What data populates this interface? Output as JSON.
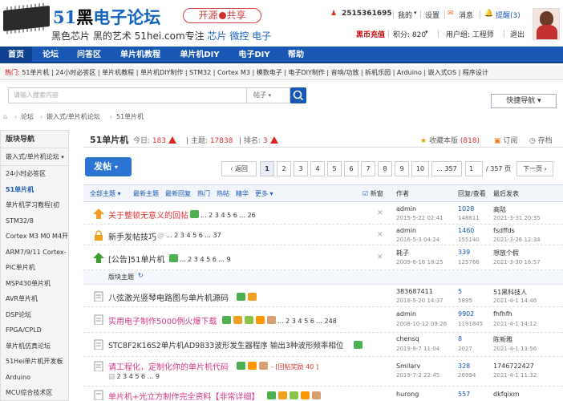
{
  "logo": {
    "title_a": "51",
    "title_b": "黑",
    "title_c": "电子论坛",
    "slogan_a": "黑色芯片 黑的艺术 51hei.com专注",
    "slogan_b": "芯片 微控 电子",
    "pill_a": "开源",
    "pill_b": "共享"
  },
  "user": {
    "qq": "2515361695",
    "my": "我的",
    "settings": "设置",
    "msg": "消息",
    "remind": "提醒(3)",
    "recharge": "黑币充值",
    "points": "积分: 820",
    "group": "用户组: 工程师",
    "logout": "退出"
  },
  "nav": {
    "items": [
      "首页",
      "论坛",
      "问答区",
      "单片机教程",
      "单片机DIY",
      "电子DIY",
      "帮助"
    ],
    "quick": "快捷导航"
  },
  "hot": {
    "label": "热门:",
    "items": "51单片机 | 24小时必答区 | 单片机教程 | 单片机DIY制作 | STM32 | Cortex M3 | 模数电子 | 电子DIY制作 | 音响/功放 | 拆机乐园 | Arduino | 嵌入式OS | 程序设计"
  },
  "search": {
    "placeholder": "请输入搜索内容",
    "type": "帖子"
  },
  "crumb": {
    "a": "论坛",
    "b": "嵌入式/单片机论坛",
    "c": "51单片机"
  },
  "side": {
    "head": "版块导航",
    "cat": "嵌入式/单片机论坛",
    "items": [
      "24小时必答区",
      "51单片机",
      "单片机学习教程(初",
      "STM32/8",
      "Cortex M3 M0 M4开",
      "ARM7/9/11 Cortex-",
      "PIC单片机",
      "MSP430单片机",
      "AVR单片机",
      "DSP论坛",
      "FPGA/CPLD",
      "单片机仿真论坛",
      "51Hei单片机开发板",
      "Arduino",
      "MCU综合技术区"
    ]
  },
  "forum": {
    "title": "51单片机",
    "today_l": "今日:",
    "today": "183",
    "topics_l": "主题:",
    "topics": "17838",
    "rank_l": "排名:",
    "rank": "3",
    "fav": "收藏本版",
    "fav_n": "(818)",
    "sub": "订阅",
    "archive": "存档"
  },
  "post_btn": "发帖",
  "pager": {
    "back": "返回",
    "pages": [
      "1",
      "2",
      "3",
      "4",
      "5",
      "6",
      "7",
      "8",
      "9",
      "10",
      "... 357"
    ],
    "input": "1",
    "total": "/ 357 页",
    "next": "下一页"
  },
  "thead": {
    "all": "全部主题",
    "new": "最新主题",
    "reply": "最新回复",
    "hot": "热门",
    "hotpost": "热帖",
    "fine": "精华",
    "more": "更多",
    "newwin": "新窗",
    "author": "作者",
    "rv": "回复/查看",
    "last": "最后发表"
  },
  "threads": [
    {
      "title": "关于整顿无意义的回帖",
      "pages": "... 2 3 4 5 6 ... 26",
      "author": "admin",
      "adate": "2015-5-22 02:41",
      "replies": "1028",
      "views": "148611",
      "last": "高陆",
      "ldate": "2021-3-31 20:35"
    },
    {
      "title": "新手发帖技巧",
      "pages": "... 2 3 4 5 6 ... 37",
      "author": "admin",
      "adate": "2016-5-3 04:24",
      "replies": "1460",
      "views": "155140",
      "last": "fsdffds",
      "ldate": "2021-3-26 12:34"
    },
    {
      "title": "[公告]51单片机",
      "pages": "... 2 3 4 5 6 ... 9",
      "author": "耗子",
      "adate": "2009-6-16 18:25",
      "replies": "339",
      "views": "125766",
      "last": "想放个假",
      "ldate": "2021-3-30 16:57"
    },
    {
      "section": "版块主题"
    },
    {
      "title": "八弦激光竖琴电路图与单片机源码",
      "pages": "",
      "author": "383687411",
      "adate": "2018-5-20 14:37",
      "replies": "5",
      "views": "5895",
      "last": "51黑科技人",
      "ldate": "2021-4-1 14:46"
    },
    {
      "title": "实用电子制作5000例火爆下载",
      "pages": "... 2 3 4 5 6 ... 248",
      "author": "admin",
      "adate": "2008-10-12 09:26",
      "replies": "9902",
      "views": "1191845",
      "last": "fhfhfh",
      "ldate": "2021-4-1 14:12"
    },
    {
      "title": "STC8F2K16S2单片机AD9833波形发生器程序 输出3种波形频率相位",
      "pages": "",
      "author": "chensq",
      "adate": "2019-8-7 11:04",
      "replies": "8",
      "views": "2027",
      "last": "陈新雅",
      "ldate": "2021-4-1 13:56"
    },
    {
      "title": "请工程化，定制化你的单片机代码",
      "pages": "2 3 4 5 6 ... 9",
      "reward": "- [回帖奖励 40 ]",
      "author": "Smilarv",
      "adate": "2019-7-2 22:45",
      "replies": "328",
      "views": "26994",
      "last": "1746722427",
      "ldate": "2021-4-1 11:32"
    },
    {
      "title": "单片机+光立方制作完全资料【非常详细】",
      "pages": "",
      "author": "hurong",
      "adate": "",
      "replies": "557",
      "views": "",
      "last": "dkfqixm",
      "ldate": ""
    }
  ]
}
